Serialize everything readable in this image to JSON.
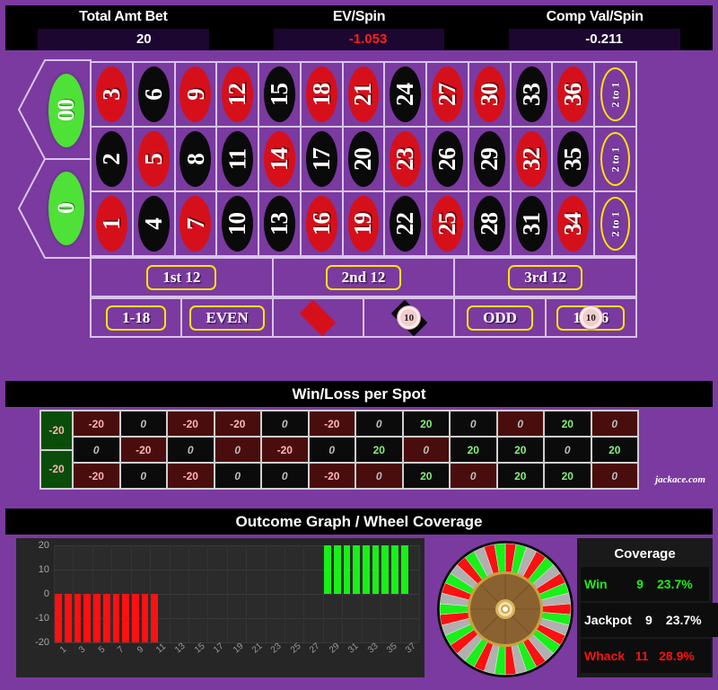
{
  "stats": {
    "items": [
      {
        "label": "Total Amt Bet",
        "value": "20",
        "negative": false
      },
      {
        "label": "EV/Spin",
        "value": "-1.053",
        "negative": true
      },
      {
        "label": "Comp Val/Spin",
        "value": "-0.211",
        "negative": false
      }
    ]
  },
  "table": {
    "zeros": [
      {
        "label": "00",
        "color": "green"
      },
      {
        "label": "0",
        "color": "green"
      }
    ],
    "numbers": [
      {
        "n": "3",
        "color": "red"
      },
      {
        "n": "6",
        "color": "black"
      },
      {
        "n": "9",
        "color": "red"
      },
      {
        "n": "12",
        "color": "red"
      },
      {
        "n": "15",
        "color": "black"
      },
      {
        "n": "18",
        "color": "red"
      },
      {
        "n": "21",
        "color": "red"
      },
      {
        "n": "24",
        "color": "black"
      },
      {
        "n": "27",
        "color": "red"
      },
      {
        "n": "30",
        "color": "red"
      },
      {
        "n": "33",
        "color": "black"
      },
      {
        "n": "36",
        "color": "red"
      },
      {
        "n": "2",
        "color": "black"
      },
      {
        "n": "5",
        "color": "red"
      },
      {
        "n": "8",
        "color": "black"
      },
      {
        "n": "11",
        "color": "black"
      },
      {
        "n": "14",
        "color": "red"
      },
      {
        "n": "17",
        "color": "black"
      },
      {
        "n": "20",
        "color": "black"
      },
      {
        "n": "23",
        "color": "red"
      },
      {
        "n": "26",
        "color": "black"
      },
      {
        "n": "29",
        "color": "black"
      },
      {
        "n": "32",
        "color": "red"
      },
      {
        "n": "35",
        "color": "black"
      },
      {
        "n": "1",
        "color": "red"
      },
      {
        "n": "4",
        "color": "black"
      },
      {
        "n": "7",
        "color": "red"
      },
      {
        "n": "10",
        "color": "black"
      },
      {
        "n": "13",
        "color": "black"
      },
      {
        "n": "16",
        "color": "red"
      },
      {
        "n": "19",
        "color": "red"
      },
      {
        "n": "22",
        "color": "black"
      },
      {
        "n": "25",
        "color": "red"
      },
      {
        "n": "28",
        "color": "black"
      },
      {
        "n": "31",
        "color": "black"
      },
      {
        "n": "34",
        "color": "red"
      }
    ],
    "column_bets": [
      "2 to 1",
      "2 to 1",
      "2 to 1"
    ],
    "dozens": [
      "1st 12",
      "2nd 12",
      "3rd 12"
    ],
    "outside": [
      {
        "kind": "text",
        "label": "1-18",
        "chip": null
      },
      {
        "kind": "text",
        "label": "EVEN",
        "chip": null
      },
      {
        "kind": "diamond",
        "label": "",
        "chip": null,
        "color": "red"
      },
      {
        "kind": "diamond",
        "label": "",
        "chip": "10",
        "color": "black"
      },
      {
        "kind": "text",
        "label": "ODD",
        "chip": null
      },
      {
        "kind": "text",
        "label": "19-36",
        "chip": "10"
      }
    ]
  },
  "winloss": {
    "title": "Win/Loss per Spot",
    "zeros": [
      "-20",
      "-20"
    ],
    "rows": [
      [
        "-20",
        "0",
        "-20",
        "-20",
        "0",
        "-20",
        "0",
        "20",
        "0",
        "0",
        "20",
        "0"
      ],
      [
        "0",
        "-20",
        "0",
        "0",
        "-20",
        "0",
        "20",
        "0",
        "20",
        "20",
        "0",
        "20"
      ],
      [
        "-20",
        "0",
        "-20",
        "0",
        "0",
        "-20",
        "0",
        "20",
        "0",
        "20",
        "20",
        "0"
      ]
    ],
    "brand": "jackace.com"
  },
  "outcome": {
    "title": "Outcome Graph / Wheel Coverage",
    "coverage": {
      "title": "Coverage",
      "rows": [
        {
          "label": "Win",
          "count": "9",
          "pct": "23.7%",
          "color": "#19f019"
        },
        {
          "label": "Jackpot",
          "count": "9",
          "pct": "23.7%",
          "color": "#ffffff"
        },
        {
          "label": "Whack",
          "count": "11",
          "pct": "28.9%",
          "color": "#fb1111"
        }
      ]
    }
  },
  "chart_data": {
    "type": "bar",
    "title": "Outcome Graph / Wheel Coverage",
    "xlabel": "",
    "ylabel": "",
    "ylim": [
      -20,
      20
    ],
    "yticks": [
      "20",
      "10",
      "0",
      "-10",
      "-20"
    ],
    "grid": true,
    "legend_position": "none",
    "categories": [
      "1",
      "2",
      "3",
      "4",
      "5",
      "6",
      "7",
      "8",
      "9",
      "10",
      "11",
      "12",
      "13",
      "14",
      "15",
      "16",
      "17",
      "18",
      "19",
      "20",
      "21",
      "22",
      "23",
      "24",
      "25",
      "26",
      "27",
      "28",
      "29",
      "30",
      "31",
      "32",
      "33",
      "34",
      "35",
      "36",
      "37",
      "38"
    ],
    "xtick_labels": [
      "1",
      "3",
      "5",
      "7",
      "9",
      "11",
      "13",
      "15",
      "17",
      "19",
      "21",
      "23",
      "25",
      "27",
      "29",
      "31",
      "33",
      "35",
      "37"
    ],
    "values": [
      -20,
      -20,
      -20,
      -20,
      -20,
      -20,
      -20,
      -20,
      -20,
      -20,
      -20,
      0,
      0,
      0,
      0,
      0,
      0,
      0,
      0,
      0,
      0,
      0,
      0,
      0,
      0,
      0,
      0,
      0,
      20,
      20,
      20,
      20,
      20,
      20,
      20,
      20,
      20,
      0
    ],
    "colors": {
      "positive": "#19f019",
      "negative": "#fb1111"
    }
  },
  "wheel": {
    "segment_colors": [
      "#fb1111",
      "#19f019",
      "#b0b0b0"
    ],
    "hub_color": "#8a6232",
    "rim_color": "#b0b0b0"
  }
}
